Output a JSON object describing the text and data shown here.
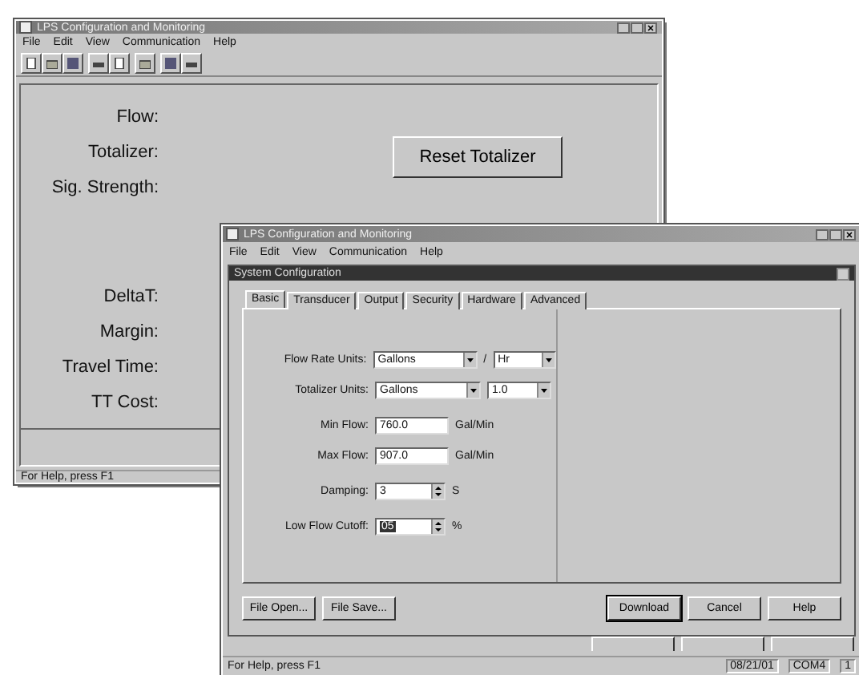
{
  "main_window": {
    "title": "LPS Configuration and Monitoring",
    "menu": [
      "File",
      "Edit",
      "View",
      "Communication",
      "Help"
    ],
    "toolbar": [
      [
        {
          "kind": "document"
        },
        {
          "kind": "folder"
        },
        {
          "kind": "disk"
        }
      ],
      [
        {
          "kind": "printer"
        },
        {
          "kind": "document"
        }
      ],
      [
        {
          "kind": "folder"
        }
      ],
      [
        {
          "kind": "disk"
        },
        {
          "kind": "printer"
        }
      ]
    ],
    "readings": [
      {
        "label": "Flow:"
      },
      {
        "label": "Totalizer:"
      },
      {
        "label": "Sig. Strength:"
      },
      {
        "label": "DeltaT:"
      },
      {
        "label": "Margin:"
      },
      {
        "label": "Travel Time:"
      },
      {
        "label": "TT Cost:"
      }
    ],
    "reset_button": "Reset Totalizer",
    "status_bar": "For Help, press F1"
  },
  "config_window": {
    "title": "LPS Configuration and Monitoring",
    "menu": [
      "File",
      "Edit",
      "View",
      "Communication",
      "Help"
    ],
    "dialog": {
      "title": "System Configuration",
      "tabs": [
        {
          "label": "Basic",
          "selected": true
        },
        {
          "label": "Transducer",
          "selected": false
        },
        {
          "label": "Output",
          "selected": false
        },
        {
          "label": "Security",
          "selected": false
        },
        {
          "label": "Hardware",
          "selected": false
        },
        {
          "label": "Advanced",
          "selected": false
        }
      ],
      "fields": [
        {
          "kind": "combo",
          "label": "Flow Rate Units:",
          "value": "Gallons",
          "second_value": "Hr",
          "separator": "/"
        },
        {
          "kind": "combo",
          "label": "Totalizer Units:",
          "value": "Gallons",
          "second_value": "1.0"
        },
        {
          "kind": "text",
          "label": "Min Flow:",
          "value": "760.0",
          "unit": "Gal/Min"
        },
        {
          "kind": "text",
          "label": "Max Flow:",
          "value": "907.0",
          "unit": "Gal/Min"
        },
        {
          "kind": "spin",
          "label": "Damping:",
          "value": "3",
          "unit": "S"
        },
        {
          "kind": "spin",
          "label": "Low Flow Cutoff:",
          "value": "05",
          "unit": "%",
          "highlighted": true
        }
      ],
      "left_buttons": [
        "File Open...",
        "File Save..."
      ],
      "right_buttons": [
        {
          "label": "Download",
          "default": true
        },
        {
          "label": "Cancel",
          "default": false
        },
        {
          "label": "Help",
          "default": false
        }
      ]
    },
    "status_bar": {
      "help": "For Help, press F1",
      "date": "08/21/01",
      "port": "COM4",
      "number": "1"
    }
  }
}
